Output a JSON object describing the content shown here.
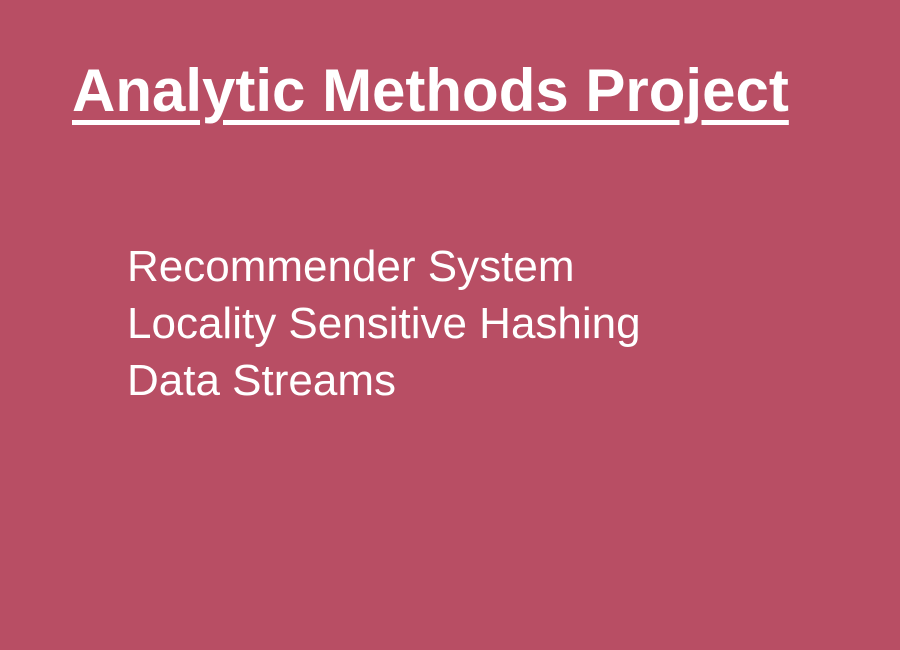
{
  "slide": {
    "title": "Analytic Methods Project",
    "items": [
      {
        "label": "Recommender System"
      },
      {
        "label": "Locality Sensitive Hashing"
      },
      {
        "label": "Data Streams"
      }
    ]
  },
  "colors": {
    "background": "#B84E64",
    "text": "#FFFFFF"
  }
}
